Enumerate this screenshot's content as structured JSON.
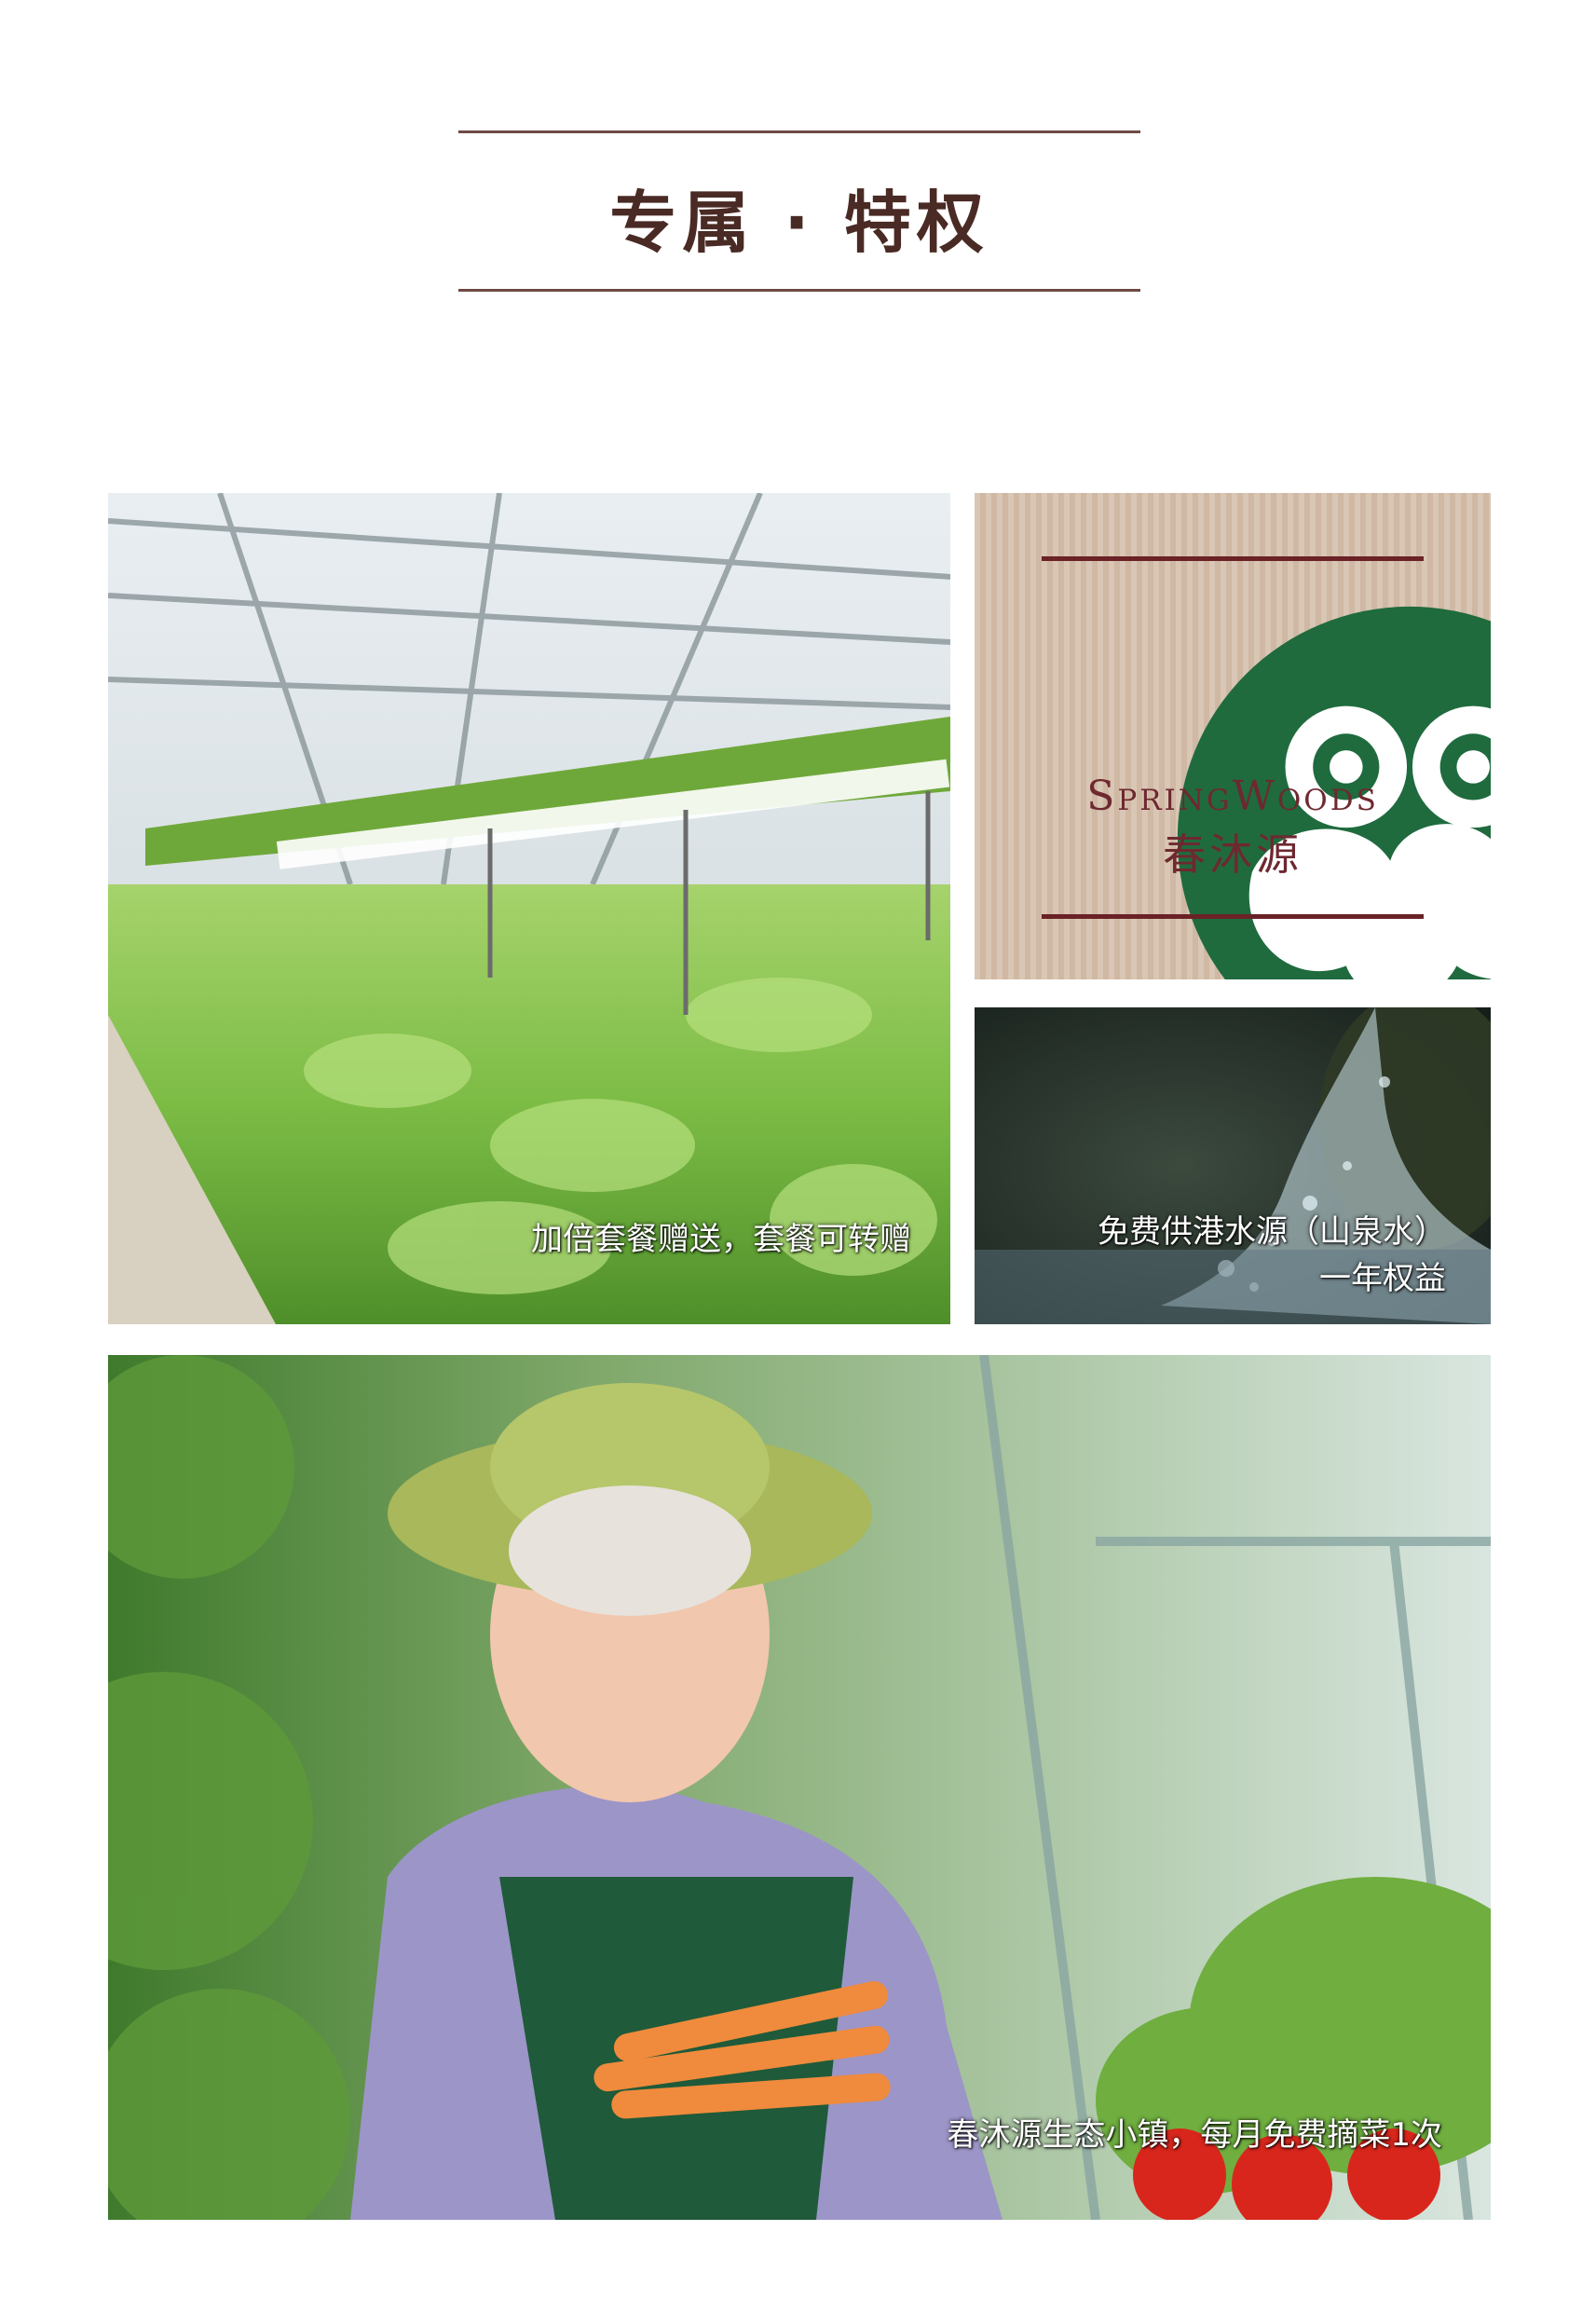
{
  "header": {
    "title": "专属 · 特权"
  },
  "tiles": {
    "greenhouse": {
      "caption": "加倍套餐赠送，套餐可转赠"
    },
    "brand": {
      "name": "SpringWoods",
      "name_cn": "春沐源",
      "logo_icon": "owl-tree-logo-icon"
    },
    "water": {
      "caption_line1": "免费供港水源（山泉水）",
      "caption_line2": "一年权益"
    },
    "farmer": {
      "caption": "春沐源生态小镇，每月免费摘菜1次"
    }
  },
  "colors": {
    "rule": "#6e4a44",
    "title": "#4a2a24",
    "brand_red": "#6e2830",
    "brand_green": "#1f6b3e"
  }
}
